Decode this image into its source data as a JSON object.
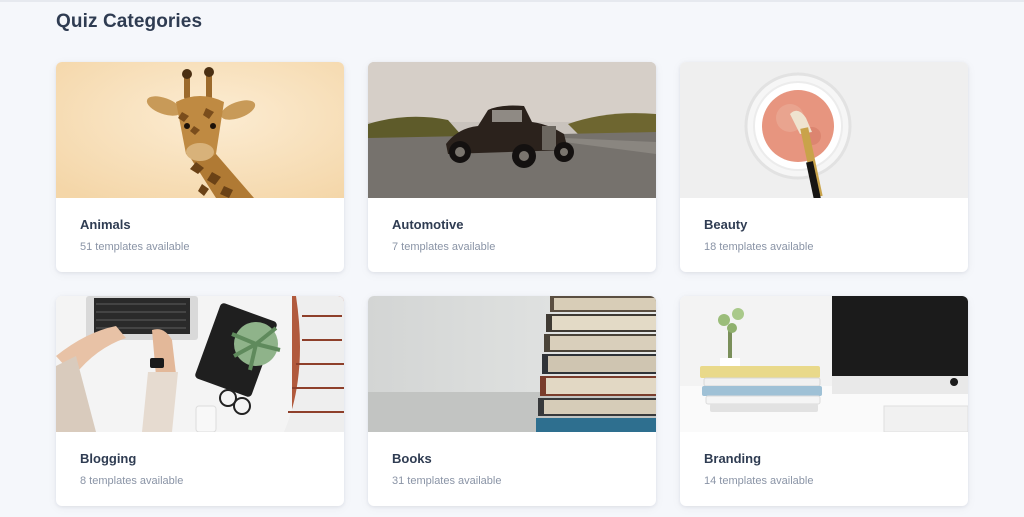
{
  "page_title": "Quiz Categories",
  "categories": [
    {
      "name": "Animals",
      "count": "51 templates available",
      "image": "giraffe-photo"
    },
    {
      "name": "Automotive",
      "count": "7 templates available",
      "image": "vintage-car-photo"
    },
    {
      "name": "Beauty",
      "count": "18 templates available",
      "image": "makeup-powder-photo"
    },
    {
      "name": "Blogging",
      "count": "8 templates available",
      "image": "laptop-desk-photo"
    },
    {
      "name": "Books",
      "count": "31 templates available",
      "image": "book-stack-photo"
    },
    {
      "name": "Branding",
      "count": "14 templates available",
      "image": "desk-monitor-photo"
    }
  ],
  "colors": {
    "background": "#f5f7fb",
    "card": "#ffffff",
    "heading": "#2f3c52",
    "muted": "#8a94a6"
  }
}
